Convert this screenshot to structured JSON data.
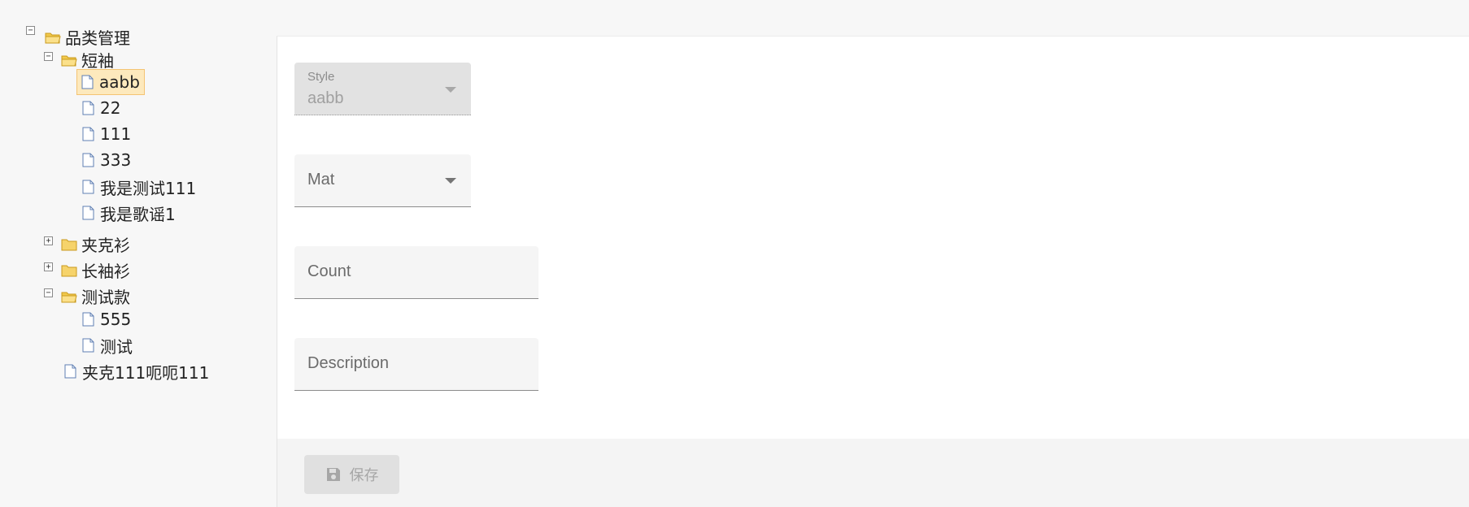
{
  "tree": {
    "root": {
      "label": "品类管理",
      "expanded": true
    },
    "nodes": [
      {
        "label": "短袖",
        "expanded": true
      },
      {
        "label": "aabb",
        "selected": true
      },
      {
        "label": "22"
      },
      {
        "label": "111"
      },
      {
        "label": "333"
      },
      {
        "label": "我是测试111"
      },
      {
        "label": "我是歌谣1"
      },
      {
        "label": "夹克衫",
        "expanded": false
      },
      {
        "label": "长袖衫",
        "expanded": false
      },
      {
        "label": "测试款",
        "expanded": true
      },
      {
        "label": "555"
      },
      {
        "label": "测试"
      },
      {
        "label": "夹克111呃呃111"
      }
    ],
    "toggle_expanded": "−",
    "toggle_collapsed": "+"
  },
  "form": {
    "style": {
      "label": "Style",
      "value": "aabb",
      "disabled": true
    },
    "mat": {
      "placeholder": "Mat"
    },
    "count": {
      "placeholder": "Count"
    },
    "description": {
      "placeholder": "Description"
    }
  },
  "footer": {
    "save_label": "保存"
  },
  "colors": {
    "selected_bg": "#fde9bd",
    "selected_border": "#f4c473",
    "folder": "#f2c94c"
  }
}
